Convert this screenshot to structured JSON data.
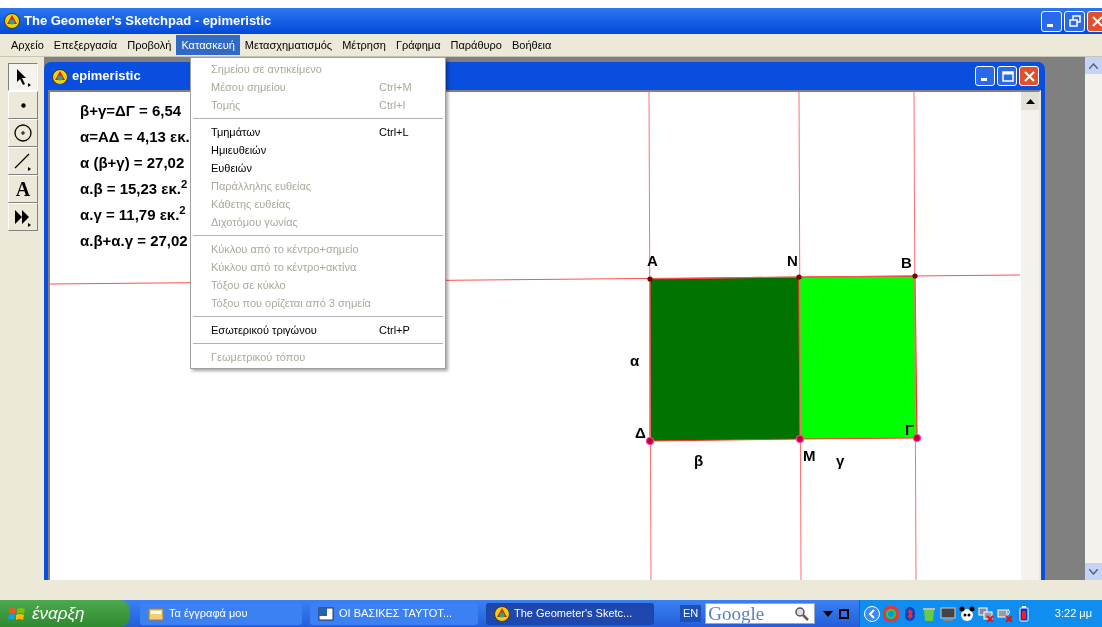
{
  "window": {
    "title": "The Geometer's Sketchpad - epimeristic"
  },
  "menubar": [
    {
      "label": "Αρχείο",
      "selected": false
    },
    {
      "label": "Επεξεργασία",
      "selected": false
    },
    {
      "label": "Προβολή",
      "selected": false
    },
    {
      "label": "Κατασκευή",
      "selected": true
    },
    {
      "label": "Μετασχηματισμός",
      "selected": false
    },
    {
      "label": "Μέτρηση",
      "selected": false
    },
    {
      "label": "Γράφημα",
      "selected": false
    },
    {
      "label": "Παράθυρο",
      "selected": false
    },
    {
      "label": "Βοήθεια",
      "selected": false
    }
  ],
  "menu": [
    {
      "kind": "item",
      "label": "Σημείου σε αντικείμενο",
      "disabled": true
    },
    {
      "kind": "item",
      "label": "Μέσου σημείου",
      "shortcut": "Ctrl+M",
      "disabled": true
    },
    {
      "kind": "item",
      "label": "Τομής",
      "shortcut": "Ctrl+I",
      "disabled": true
    },
    {
      "kind": "separator"
    },
    {
      "kind": "item",
      "label": "Τμημάτων",
      "shortcut": "Ctrl+L",
      "disabled": false
    },
    {
      "kind": "item",
      "label": "Ημιευθειών",
      "disabled": false
    },
    {
      "kind": "item",
      "label": "Ευθειών",
      "disabled": false
    },
    {
      "kind": "item",
      "label": "Παράλληλης ευθείας",
      "disabled": true
    },
    {
      "kind": "item",
      "label": "Κάθετης ευθείας",
      "disabled": true
    },
    {
      "kind": "item",
      "label": "Διχοτόμου γωνίας",
      "disabled": true
    },
    {
      "kind": "separator"
    },
    {
      "kind": "item",
      "label": "Κύκλου από το κέντρο+σημείο",
      "disabled": true
    },
    {
      "kind": "item",
      "label": "Κύκλου από το κέντρο+ακτίνα",
      "disabled": true
    },
    {
      "kind": "item",
      "label": "Τόξου σε κύκλο",
      "disabled": true
    },
    {
      "kind": "item",
      "label": "Τόξου που ορίζεται από 3 σημεία",
      "disabled": true
    },
    {
      "kind": "separator"
    },
    {
      "kind": "item",
      "label": "Εσωτερικού τριγώνου",
      "shortcut": "Ctrl+P",
      "disabled": false
    },
    {
      "kind": "separator"
    },
    {
      "kind": "item",
      "label": "Γεωμετρικού τόπου",
      "disabled": true
    }
  ],
  "tools": [
    {
      "kind": "arrow",
      "selected": true
    },
    {
      "kind": "point",
      "selected": false
    },
    {
      "kind": "compass",
      "selected": false
    },
    {
      "kind": "straightedge",
      "selected": false
    },
    {
      "kind": "text",
      "glyph": "A",
      "selected": false
    },
    {
      "kind": "custom",
      "selected": false
    }
  ],
  "document": {
    "title": "epimeristic",
    "measurements": [
      "β+γ=ΔΓ = 6,54",
      "α=ΑΔ = 4,13 εκ.",
      "α (β+γ) = 27,02",
      "α.β = 15,23 εκ.$^{2}$",
      "α.γ = 11,79 εκ.$^{2}$",
      "α.β+α.γ = 27,02"
    ],
    "regions": [
      {
        "color": "#007300"
      },
      {
        "color": "#00ff00"
      }
    ],
    "points": [
      "Α",
      "Ν",
      "Β",
      "Δ",
      "Μ",
      "Γ"
    ],
    "segment_labels": [
      "α",
      "β",
      "γ"
    ]
  },
  "taskbar": {
    "start": "έναρξη",
    "tasks": [
      {
        "kind": "folder",
        "label": "Τα έγγραφά μου",
        "selected": false
      },
      {
        "kind": "word",
        "label": "ΟΙ  ΒΑΣΙΚΕΣ  ΤΑΥΤΟΤ...",
        "selected": false
      },
      {
        "kind": "sketchpad",
        "label": "The Geometer's Sketc...",
        "selected": true
      }
    ],
    "language": "EN",
    "search": {
      "placeholder": "Google"
    },
    "clock": "3:22 μμ"
  }
}
